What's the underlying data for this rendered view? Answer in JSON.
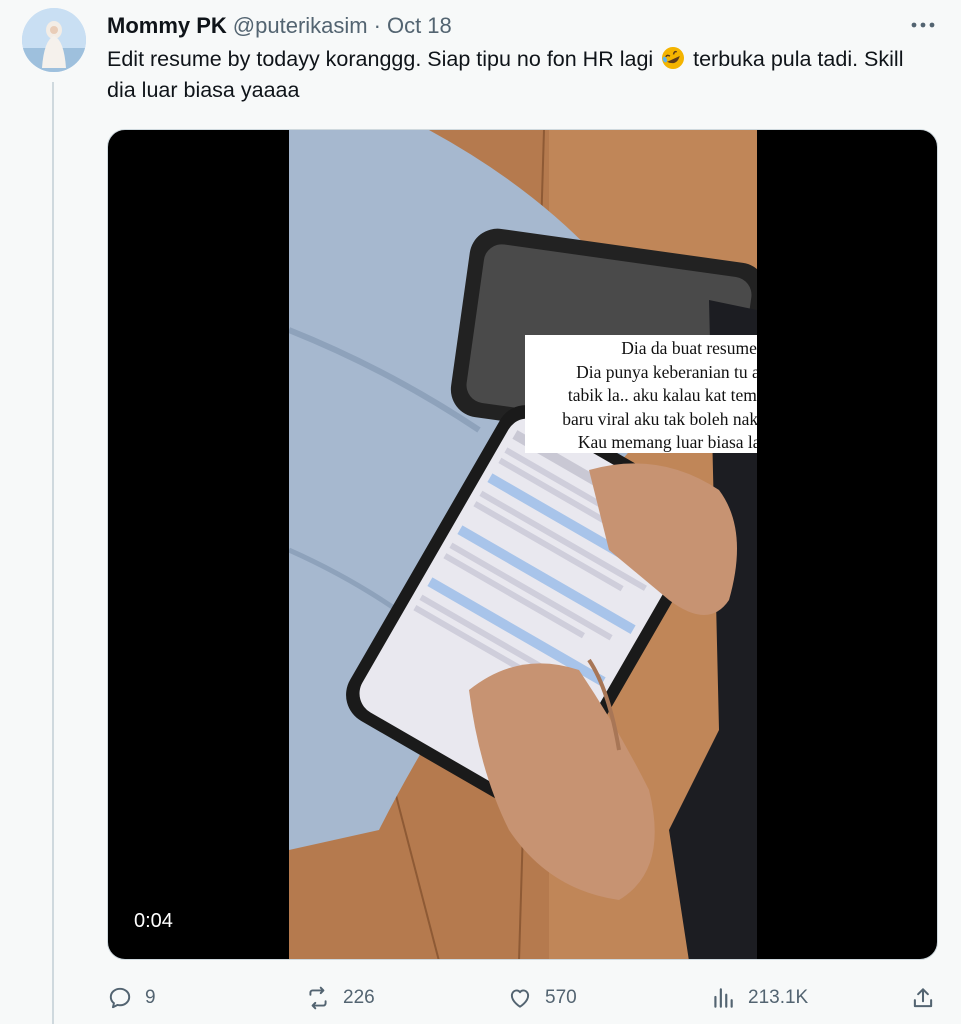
{
  "tweet": {
    "author_name": "Mommy PK",
    "handle": "@puterikasim",
    "separator": "·",
    "date": "Oct 18",
    "text_part1": "Edit resume by todayy koranggg. Siap tipu no fon HR lagi ",
    "emoji": "rolling-on-floor-laughing",
    "text_part2": " terbuka pula tadi. Skill dia luar biasa yaaaa"
  },
  "video": {
    "timestamp": "0:04",
    "caption_lines": [
      "Dia da buat resume baru.",
      "Dia punya keberanian tu aku memang",
      "tabik la.. aku kalau kat tempat dia benda",
      "baru viral aku tak boleh nak bernafas dah.",
      "Kau memang luar biasa la pazelah"
    ],
    "caption_emphasis": "‼️"
  },
  "actions": {
    "replies": "9",
    "retweets": "226",
    "likes": "570",
    "views": "213.1K"
  },
  "icons": [
    "more-icon",
    "reply-icon",
    "retweet-icon",
    "like-icon",
    "views-icon",
    "share-icon"
  ],
  "colors": {
    "secondary_text": "#536471",
    "border": "#cfd9de",
    "background": "#f7f9f9"
  }
}
